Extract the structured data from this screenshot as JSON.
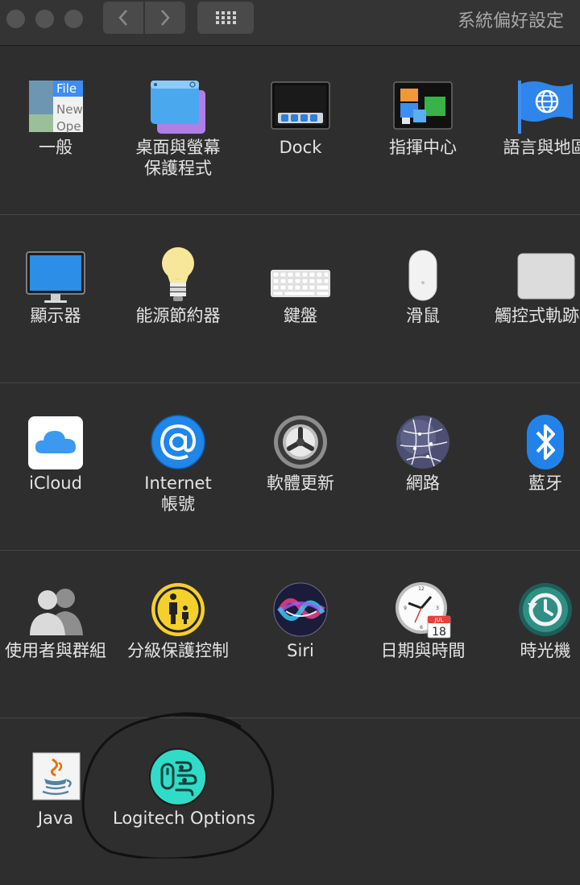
{
  "window": {
    "title": "系統偏好設定"
  },
  "toolbar": {
    "back_icon": "chevron-left-icon",
    "forward_icon": "chevron-right-icon",
    "show_all_icon": "grid-icon"
  },
  "rows": [
    {
      "panes": [
        {
          "label": [
            "一般"
          ],
          "icon": "general-icon"
        },
        {
          "label": [
            "桌面與螢幕",
            "保護程式"
          ],
          "icon": "desktop-screensaver-icon"
        },
        {
          "label": [
            "Dock"
          ],
          "icon": "dock-icon"
        },
        {
          "label": [
            "指揮中心"
          ],
          "icon": "mission-control-icon"
        },
        {
          "label": [
            "語言與地區"
          ],
          "icon": "language-region-icon"
        }
      ]
    },
    {
      "panes": [
        {
          "label": [
            "顯示器"
          ],
          "icon": "display-icon"
        },
        {
          "label": [
            "能源節約器"
          ],
          "icon": "energy-saver-icon"
        },
        {
          "label": [
            "鍵盤"
          ],
          "icon": "keyboard-icon"
        },
        {
          "label": [
            "滑鼠"
          ],
          "icon": "mouse-icon"
        },
        {
          "label": [
            "觸控式軌跡板"
          ],
          "icon": "trackpad-icon"
        }
      ]
    },
    {
      "panes": [
        {
          "label": [
            "iCloud"
          ],
          "icon": "icloud-icon"
        },
        {
          "label": [
            "Internet",
            "帳號"
          ],
          "icon": "internet-accounts-icon"
        },
        {
          "label": [
            "軟體更新"
          ],
          "icon": "software-update-icon"
        },
        {
          "label": [
            "網路"
          ],
          "icon": "network-icon"
        },
        {
          "label": [
            "藍牙"
          ],
          "icon": "bluetooth-icon"
        }
      ]
    },
    {
      "panes": [
        {
          "label": [
            "使用者與群組"
          ],
          "icon": "users-groups-icon"
        },
        {
          "label": [
            "分級保護控制"
          ],
          "icon": "parental-controls-icon"
        },
        {
          "label": [
            "Siri"
          ],
          "icon": "siri-icon"
        },
        {
          "label": [
            "日期與時間"
          ],
          "icon": "date-time-icon"
        },
        {
          "label": [
            "時光機"
          ],
          "icon": "time-machine-icon"
        }
      ]
    },
    {
      "panes": [
        {
          "label": [
            "Java"
          ],
          "icon": "java-icon"
        },
        {
          "label": [
            "Logitech Options"
          ],
          "icon": "logitech-options-icon"
        }
      ]
    }
  ],
  "icon_text": {
    "general_file": "File",
    "general_new": "New",
    "general_open": "Ope",
    "calendar_month": "JUL",
    "calendar_day": "18"
  },
  "colors": {
    "window_background": "#2f2e2e",
    "titlebar": "#353434",
    "separator": "#474646",
    "label_text": "#e4e4e4",
    "annotation_circle": "#111111"
  }
}
